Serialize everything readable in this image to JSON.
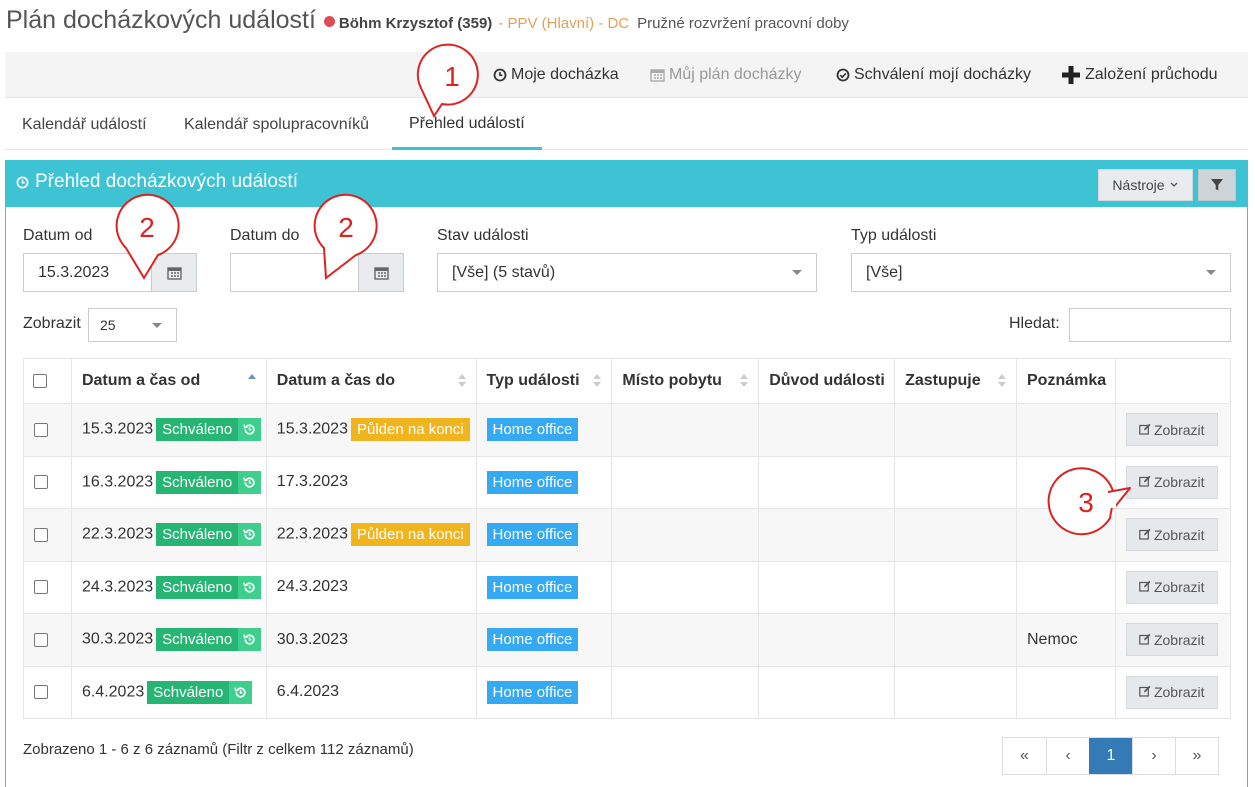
{
  "header": {
    "title": "Plán docházkových událostí",
    "person": "Böhm Krzysztof (359)",
    "org": "- PPV (Hlavní) - DC",
    "schedule": "Pružné rozvržení pracovní doby",
    "status_color": "#dd4b55"
  },
  "actions": [
    {
      "label": "Moje docházka",
      "icon": "clock-icon"
    },
    {
      "label": "Můj plán docházky",
      "icon": "calendar-icon",
      "disabled": true
    },
    {
      "label": "Schválení mojí docházky",
      "icon": "check-circle-icon"
    },
    {
      "label": "Založení průchodu",
      "icon": "plus-icon"
    }
  ],
  "tabs": [
    {
      "label": "Kalendář událostí"
    },
    {
      "label": "Kalendář spolupracovníků"
    },
    {
      "label": "Přehled událostí",
      "active": true
    }
  ],
  "panel": {
    "title": "Přehled docházkových událostí",
    "tools_label": "Nástroje",
    "accent": "#3ec3d5"
  },
  "filters": {
    "date_from_label": "Datum od",
    "date_from_value": "15.3.2023",
    "date_to_label": "Datum do",
    "date_to_value": "",
    "status_label": "Stav události",
    "status_value": "[Vše] (5 stavů)",
    "type_label": "Typ události",
    "type_value": "[Vše]",
    "show_label": "Zobrazit",
    "show_value": "25",
    "search_label": "Hledat:"
  },
  "table": {
    "columns": [
      "Datum a čas od",
      "Datum a čas do",
      "Typ události",
      "Místo pobytu",
      "Důvod události",
      "Zastupuje",
      "Poznámka"
    ],
    "action_label": "Zobrazit",
    "rows": [
      {
        "from": "15.3.2023",
        "from_badge": "Schváleno",
        "to": "15.3.2023",
        "to_badge": "Půlden na konci",
        "type": "Home office",
        "place": "",
        "reason": "",
        "substitute": "",
        "note": ""
      },
      {
        "from": "16.3.2023",
        "from_badge": "Schváleno",
        "to": "17.3.2023",
        "to_badge": "",
        "type": "Home office",
        "place": "",
        "reason": "",
        "substitute": "",
        "note": ""
      },
      {
        "from": "22.3.2023",
        "from_badge": "Schváleno",
        "to": "22.3.2023",
        "to_badge": "Půlden na konci",
        "type": "Home office",
        "place": "",
        "reason": "",
        "substitute": "",
        "note": ""
      },
      {
        "from": "24.3.2023",
        "from_badge": "Schváleno",
        "to": "24.3.2023",
        "to_badge": "",
        "type": "Home office",
        "place": "",
        "reason": "",
        "substitute": "",
        "note": ""
      },
      {
        "from": "30.3.2023",
        "from_badge": "Schváleno",
        "to": "30.3.2023",
        "to_badge": "",
        "type": "Home office",
        "place": "",
        "reason": "",
        "substitute": "",
        "note": "Nemoc"
      },
      {
        "from": "6.4.2023",
        "from_badge": "Schváleno",
        "to": "6.4.2023",
        "to_badge": "",
        "type": "Home office",
        "place": "",
        "reason": "",
        "substitute": "",
        "note": ""
      }
    ]
  },
  "footer": {
    "info": "Zobrazeno 1 - 6 z 6 záznamů (Filtr z celkem 112 záznamů)",
    "pager": [
      "«",
      "‹",
      "1",
      "›",
      "»"
    ],
    "current_page": "1"
  },
  "callouts": [
    "1",
    "2",
    "2",
    "3"
  ]
}
